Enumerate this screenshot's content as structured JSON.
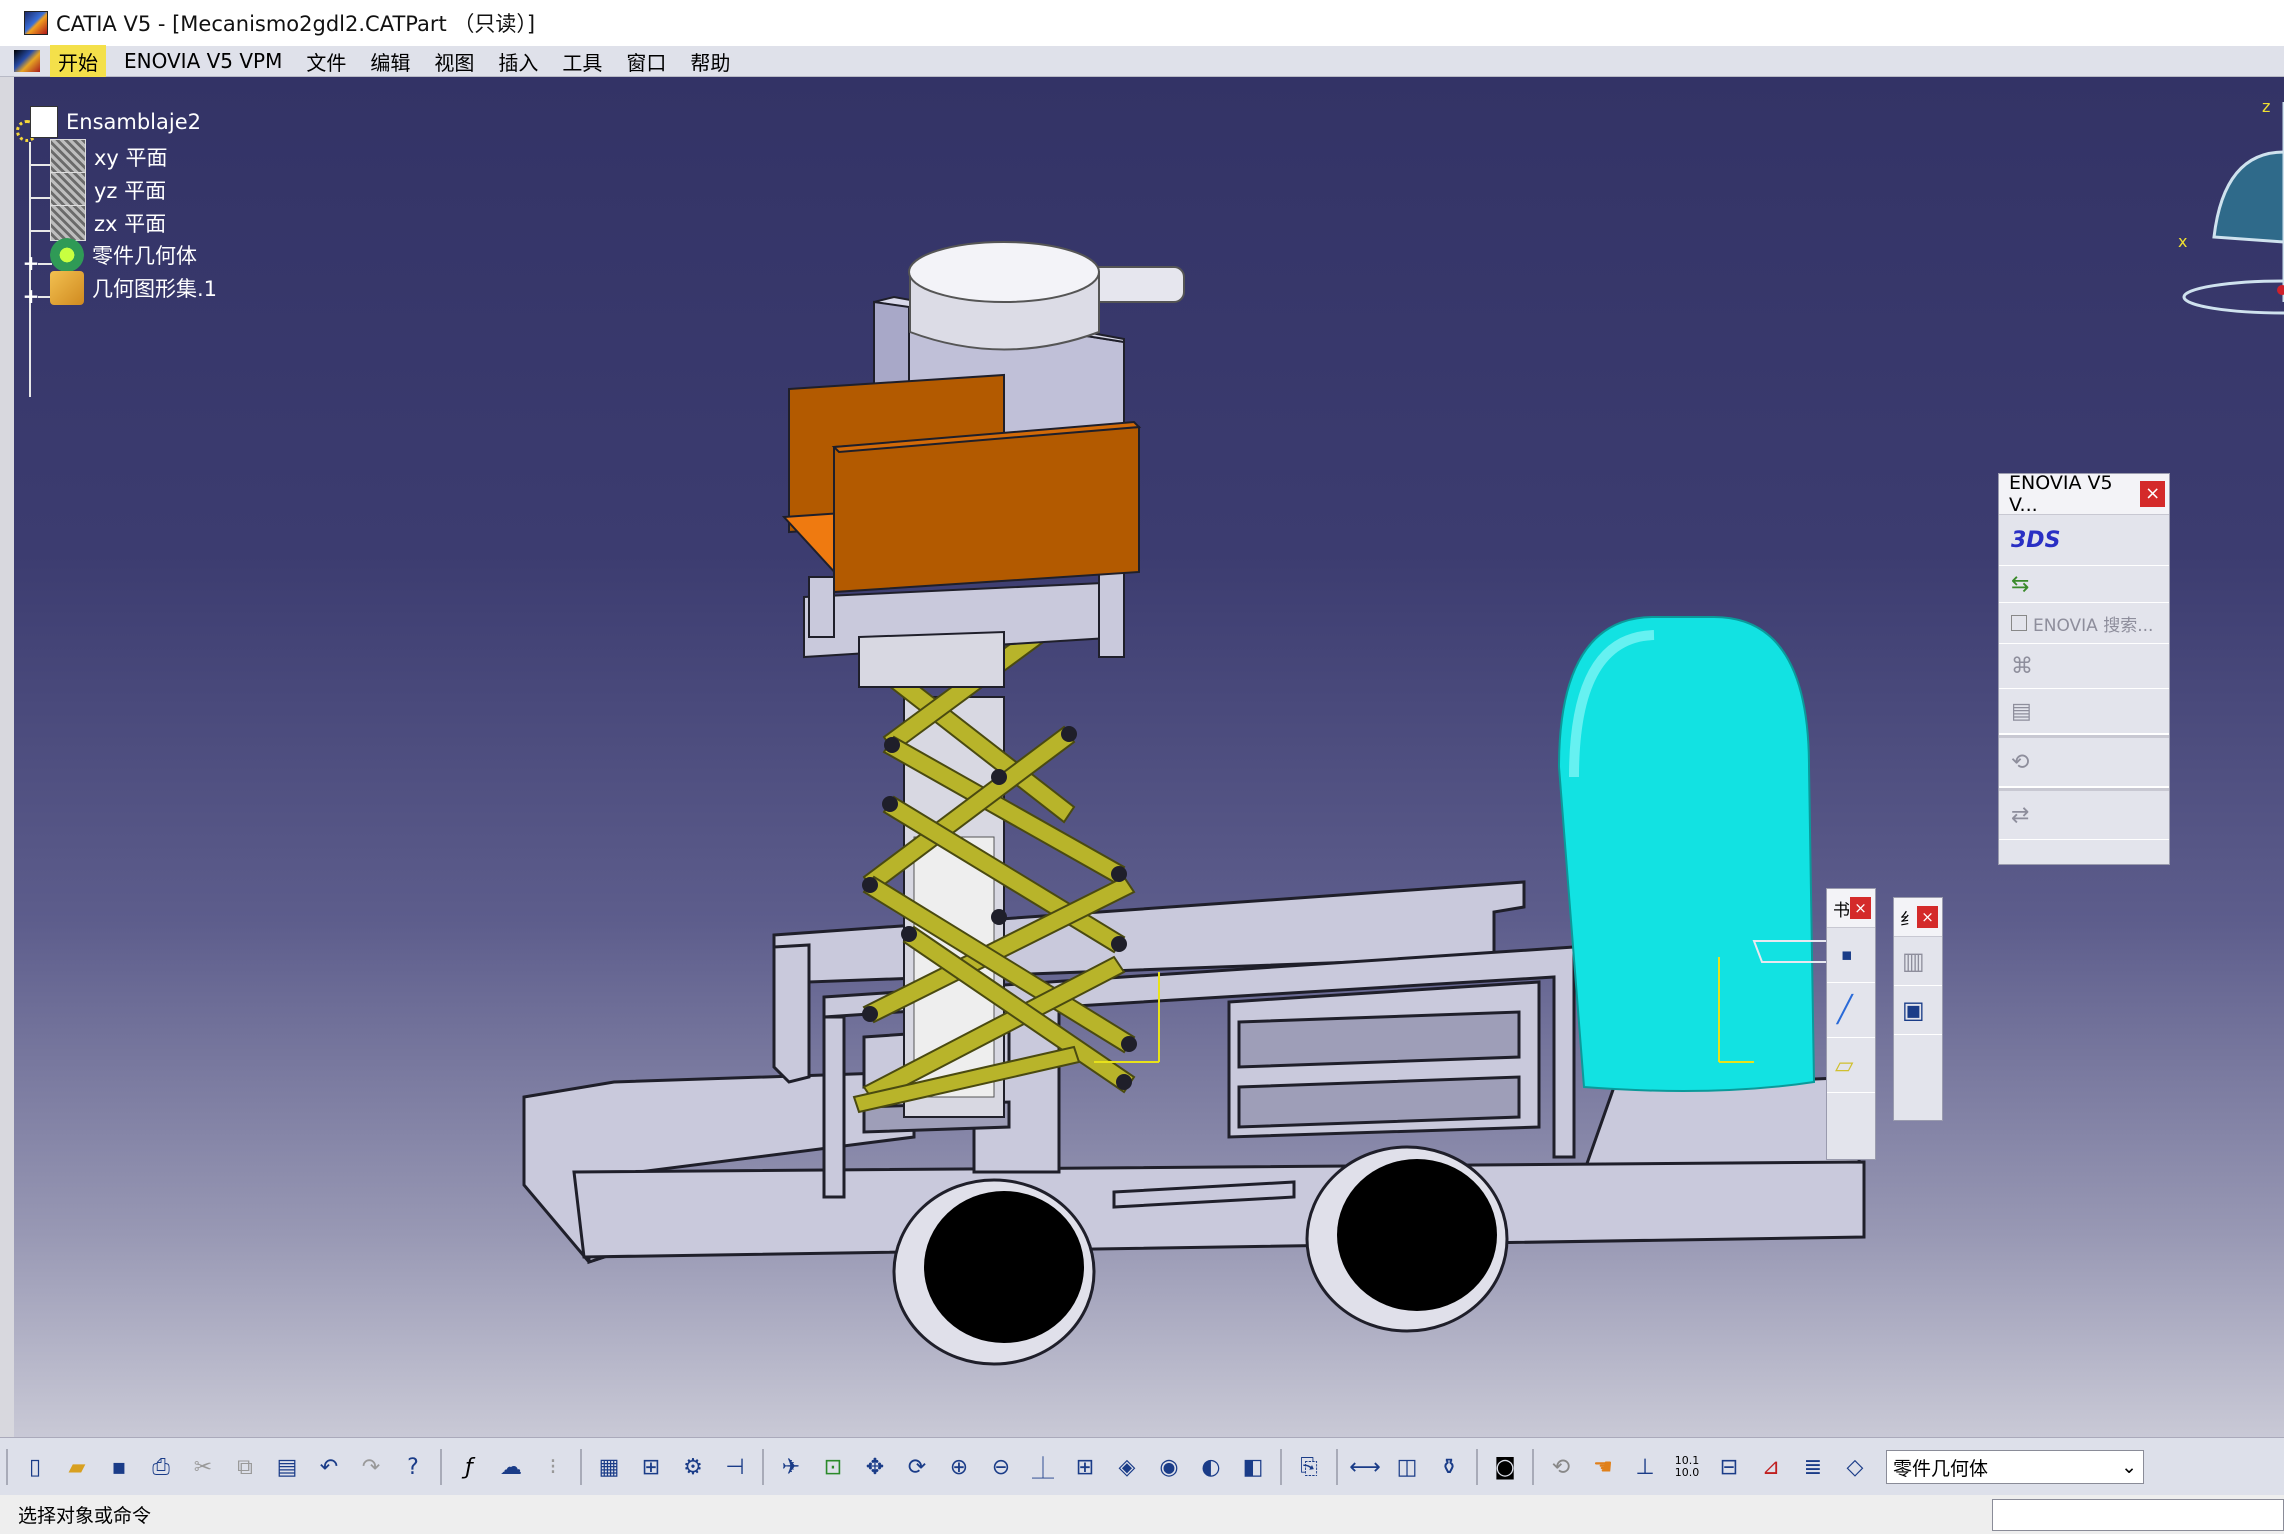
{
  "window": {
    "title": "CATIA V5 - [Mecanismo2gdl2.CATPart （只读）]"
  },
  "menubar": {
    "items": [
      {
        "label": "开始",
        "active": true
      },
      {
        "label": "ENOVIA V5 VPM"
      },
      {
        "label": "文件"
      },
      {
        "label": "编辑"
      },
      {
        "label": "视图"
      },
      {
        "label": "插入"
      },
      {
        "label": "工具"
      },
      {
        "label": "窗口"
      },
      {
        "label": "帮助"
      }
    ]
  },
  "spec_tree": {
    "root": "Ensamblaje2",
    "children": [
      {
        "label": "xy 平面",
        "icon": "plane-icon"
      },
      {
        "label": "yz 平面",
        "icon": "plane-icon"
      },
      {
        "label": "zx 平面",
        "icon": "plane-icon"
      },
      {
        "label": "零件几何体",
        "icon": "part-body-icon",
        "expandable": true
      },
      {
        "label": "几何图形集.1",
        "icon": "geometrical-set-icon",
        "expandable": true
      }
    ]
  },
  "compass": {
    "axes": [
      "z",
      "x"
    ]
  },
  "enovia_toolbar": {
    "title": "ENOVIA V5 V...",
    "close_label": "×",
    "search_label": "ENOVIA 搜索..."
  },
  "small_toolbar_1": {
    "title": "书",
    "close_label": "×"
  },
  "small_toolbar_2": {
    "title": "纟",
    "close_label": "×"
  },
  "bottom_toolbar": {
    "workbench_value": "零件几何体",
    "ratio_label_top": "10.1",
    "ratio_label_bottom": "10.0"
  },
  "statusbar": {
    "message": "选择对象或命令"
  },
  "colors": {
    "viewport_top": "#333366",
    "viewport_bottom": "#c9c9d6",
    "chassis": "#c9c9dc",
    "tank": "#12e2e2",
    "scissor": "#b8b42a",
    "orange_plate": "#b35a00",
    "wheel": "#000000"
  }
}
